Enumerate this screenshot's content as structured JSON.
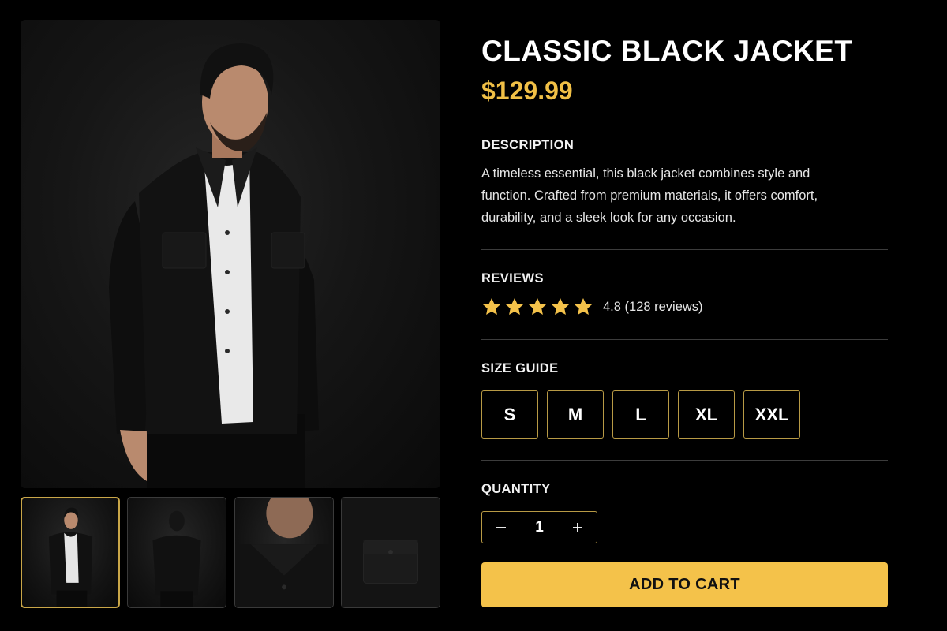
{
  "product": {
    "title": "CLASSIC BLACK JACKET",
    "price": "$129.99"
  },
  "gallery": {
    "main_image": "man-in-black-jacket-front-photo",
    "thumbnails": [
      {
        "image": "front-view-photo",
        "active": true
      },
      {
        "image": "back-view-photo",
        "active": false
      },
      {
        "image": "collar-closeup-photo",
        "active": false
      },
      {
        "image": "pocket-closeup-photo",
        "active": false
      }
    ]
  },
  "description": {
    "label": "DESCRIPTION",
    "text": "A timeless essential, this black jacket combines style and function. Crafted from premium materials, it offers comfort, durability, and a sleek look for any occasion."
  },
  "reviews": {
    "label": "REVIEWS",
    "stars": 5,
    "rating_text": "4.8 (128 reviews)"
  },
  "size_guide": {
    "label": "SIZE GUIDE",
    "sizes": [
      "S",
      "M",
      "L",
      "XL",
      "XXL"
    ]
  },
  "quantity": {
    "label": "QUANTITY",
    "value": "1",
    "decrement_icon": "minus-icon",
    "increment_icon": "plus-icon"
  },
  "cart": {
    "label": "ADD TO CART"
  },
  "colors": {
    "background": "#000000",
    "accent": "#f4c24a",
    "price": "#f1c046",
    "outline": "#b89a45"
  }
}
